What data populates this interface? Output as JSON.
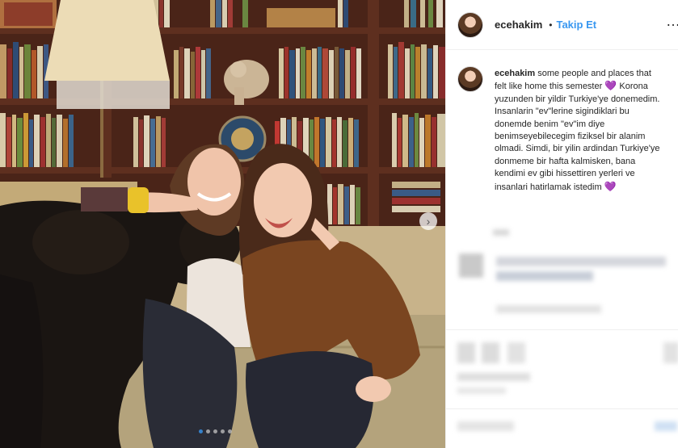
{
  "header": {
    "username": "ecehakim",
    "separator": "•",
    "follow_label": "Takip Et",
    "more_icon": "…"
  },
  "caption": {
    "username": "ecehakim",
    "text_part1": "some people and places that felt like home this semester",
    "heart1": "💜",
    "text_part2": "Korona yuzunden bir yildir Turkiye'ye donemedim. Insanlarin \"ev\"lerine sigindiklari bu donemde benim \"ev\"im diye benimseyebilecegim fiziksel bir alanim olmadi. Simdi, bir yilin ardindan Turkiye'ye donmeme bir hafta kalmisken, bana kendimi ev gibi hissettiren yerleri ve insanlari hatirlamak istedim",
    "heart2": "💜"
  },
  "photo": {
    "next_icon": "›",
    "carousel_count": 5
  },
  "colors": {
    "link": "#3897f0",
    "text": "#262626",
    "heart": "#8e4ad8"
  }
}
